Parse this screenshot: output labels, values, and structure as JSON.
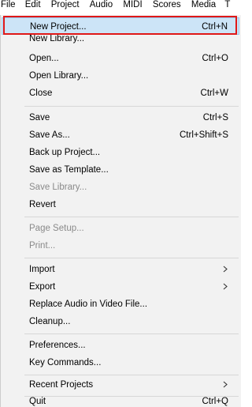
{
  "menubar": {
    "items": [
      "File",
      "Edit",
      "Project",
      "Audio",
      "MIDI",
      "Scores",
      "Media",
      "T"
    ],
    "active": "File"
  },
  "menu": {
    "new_project": {
      "label": "New Project...",
      "shortcut": "Ctrl+N"
    },
    "new_library": {
      "label": "New Library..."
    },
    "open": {
      "label": "Open...",
      "shortcut": "Ctrl+O"
    },
    "open_library": {
      "label": "Open Library..."
    },
    "close": {
      "label": "Close",
      "shortcut": "Ctrl+W"
    },
    "save": {
      "label": "Save",
      "shortcut": "Ctrl+S"
    },
    "save_as": {
      "label": "Save As...",
      "shortcut": "Ctrl+Shift+S"
    },
    "back_up_project": {
      "label": "Back up Project..."
    },
    "save_as_template": {
      "label": "Save as Template..."
    },
    "save_library": {
      "label": "Save Library..."
    },
    "revert": {
      "label": "Revert"
    },
    "page_setup": {
      "label": "Page Setup..."
    },
    "print": {
      "label": "Print..."
    },
    "import": {
      "label": "Import"
    },
    "export": {
      "label": "Export"
    },
    "replace_audio": {
      "label": "Replace Audio in Video File..."
    },
    "cleanup": {
      "label": "Cleanup..."
    },
    "preferences": {
      "label": "Preferences..."
    },
    "key_commands": {
      "label": "Key Commands..."
    },
    "recent_projects": {
      "label": "Recent Projects"
    },
    "quit": {
      "label": "Quit",
      "shortcut": "Ctrl+Q"
    }
  },
  "colors": {
    "highlight": "#cce4f7",
    "annotation": "#e01818",
    "disabled_text": "#8a8a8a"
  }
}
